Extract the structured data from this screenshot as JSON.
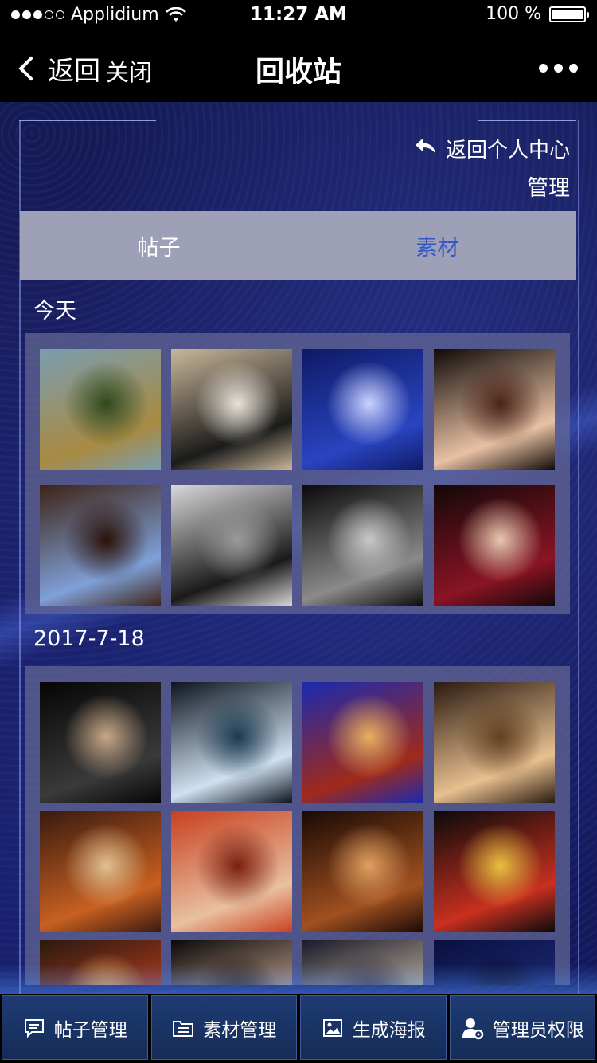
{
  "status_bar": {
    "carrier": "Applidium",
    "time": "11:27 AM",
    "battery": "100 %"
  },
  "nav": {
    "back_label": "返回",
    "close_label": "关闭",
    "title": "回收站"
  },
  "header": {
    "back_center_label": "返回个人中心",
    "manage_label": "管理"
  },
  "tabs": [
    {
      "label": "帖子",
      "active": false
    },
    {
      "label": "素材",
      "active": true
    }
  ],
  "sections": [
    {
      "title": "今天",
      "images": [
        {
          "icon": "photo-dancer-field",
          "colors": [
            "#7a9eb0",
            "#a88a42",
            "#2f4a1e"
          ]
        },
        {
          "icon": "photo-boys-piano",
          "colors": [
            "#c9b79a",
            "#1b1b1b",
            "#e8e4dc"
          ]
        },
        {
          "icon": "photo-stage-dance",
          "colors": [
            "#0e1a66",
            "#2a44c0",
            "#c9d3ff"
          ]
        },
        {
          "icon": "photo-dancer-closeup",
          "colors": [
            "#100a08",
            "#e8c1a4",
            "#4a2418"
          ]
        },
        {
          "icon": "photo-cellist",
          "colors": [
            "#3e2416",
            "#7fa0d8",
            "#2a1208"
          ]
        },
        {
          "icon": "photo-orchestra-group",
          "colors": [
            "#d8d8d8",
            "#1a1a1a",
            "#9a9a9a"
          ]
        },
        {
          "icon": "photo-opera-scene",
          "colors": [
            "#0a0a0a",
            "#8a8a8a",
            "#c8c8c8"
          ]
        },
        {
          "icon": "photo-two-singers",
          "colors": [
            "#120808",
            "#8a1424",
            "#e8c8b0"
          ]
        }
      ]
    },
    {
      "title": "2017-7-18",
      "images": [
        {
          "icon": "photo-conductor",
          "colors": [
            "#050505",
            "#3a3a3a",
            "#c8a888"
          ]
        },
        {
          "icon": "photo-swan-lake",
          "colors": [
            "#0e1420",
            "#cfe0f0",
            "#1a3a50"
          ]
        },
        {
          "icon": "photo-concert-hall",
          "colors": [
            "#1a2ab0",
            "#a02a1a",
            "#e8b060"
          ]
        },
        {
          "icon": "photo-violinist",
          "colors": [
            "#2a1a10",
            "#e8c090",
            "#604020"
          ]
        },
        {
          "icon": "photo-stage-ensemble",
          "colors": [
            "#3a1a10",
            "#c86020",
            "#e0c090"
          ]
        },
        {
          "icon": "photo-violinist-red",
          "colors": [
            "#c84020",
            "#e8c0a0",
            "#7a2010"
          ]
        },
        {
          "icon": "photo-violin-closeup",
          "colors": [
            "#1a0a04",
            "#a05020",
            "#e0a060"
          ]
        },
        {
          "icon": "photo-choir",
          "colors": [
            "#0a0a0a",
            "#c83020",
            "#e8c040"
          ]
        },
        {
          "icon": "photo-performers",
          "colors": [
            "#2a1a10",
            "#c84020",
            "#e8b060"
          ]
        },
        {
          "icon": "photo-portrait",
          "colors": [
            "#0a0a0a",
            "#d8b098",
            "#2a1a14"
          ]
        },
        {
          "icon": "photo-audience",
          "colors": [
            "#1a1a2a",
            "#d8c8b0",
            "#3a3040"
          ]
        },
        {
          "icon": "photo-dark-stage",
          "colors": [
            "#0a1040",
            "#203080",
            "#0a0a20"
          ]
        }
      ]
    }
  ],
  "toolbar": [
    {
      "label": "帖子管理",
      "icon": "comment-icon"
    },
    {
      "label": "素材管理",
      "icon": "folder-icon"
    },
    {
      "label": "生成海报",
      "icon": "image-icon"
    },
    {
      "label": "管理员权限",
      "icon": "admin-user-icon"
    }
  ]
}
